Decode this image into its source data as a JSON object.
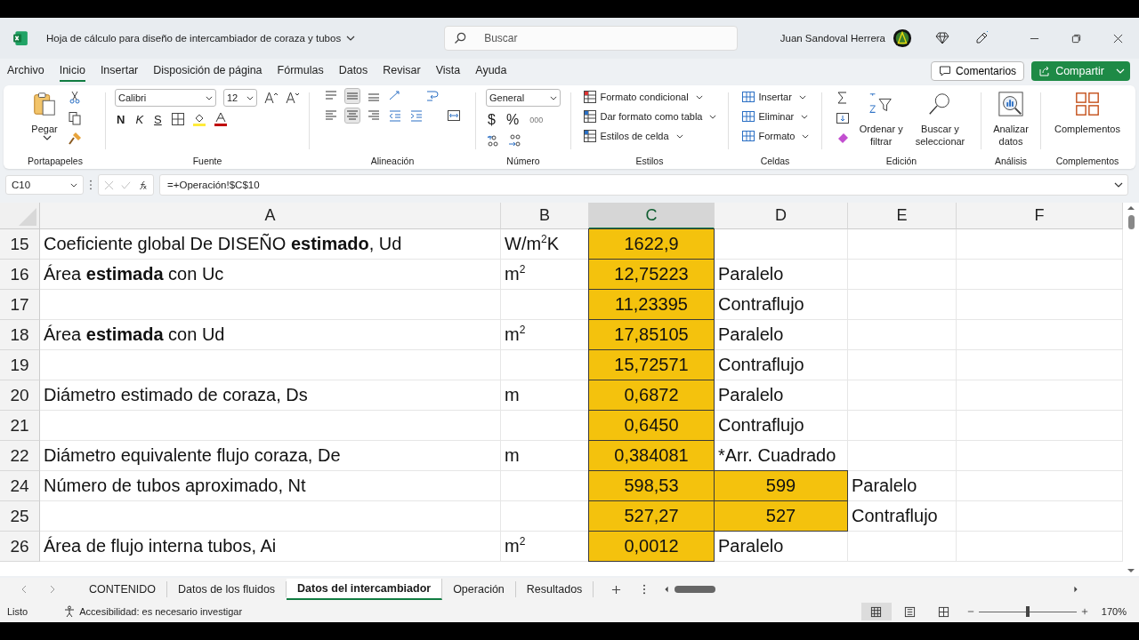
{
  "title_bar": {
    "document_title": "Hoja de cálculo para diseño de intercambiador de coraza y tubos",
    "search_placeholder": "Buscar",
    "user_name": "Juan Sandoval Herrera"
  },
  "menu_tabs": [
    {
      "label": "Archivo",
      "selected": false
    },
    {
      "label": "Inicio",
      "selected": true
    },
    {
      "label": "Insertar",
      "selected": false
    },
    {
      "label": "Disposición de página",
      "selected": false
    },
    {
      "label": "Fórmulas",
      "selected": false
    },
    {
      "label": "Datos",
      "selected": false
    },
    {
      "label": "Revisar",
      "selected": false
    },
    {
      "label": "Vista",
      "selected": false
    },
    {
      "label": "Ayuda",
      "selected": false
    }
  ],
  "actions": {
    "comments": "Comentarios",
    "share": "Compartir"
  },
  "ribbon": {
    "clipboard": {
      "paste": "Pegar",
      "label": "Portapapeles"
    },
    "font": {
      "name": "Calibri",
      "size": "12",
      "bold": "N",
      "italic": "K",
      "underline": "S",
      "label": "Fuente"
    },
    "alignment": {
      "label": "Alineación"
    },
    "number": {
      "format": "General",
      "currency": "$",
      "percent": "%",
      "thousands": "000",
      "label": "Número"
    },
    "styles": {
      "items": [
        "Formato condicional",
        "Dar formato como tabla",
        "Estilos de celda"
      ],
      "label": "Estilos"
    },
    "cells": {
      "items": [
        "Insertar",
        "Eliminar",
        "Formato"
      ],
      "label": "Celdas"
    },
    "editing": {
      "sort": [
        "Ordenar y",
        "filtrar"
      ],
      "find": [
        "Buscar y",
        "seleccionar"
      ],
      "label": "Edición"
    },
    "analysis": {
      "button": [
        "Analizar",
        "datos"
      ],
      "label": "Análisis"
    },
    "addins": {
      "button": "Complementos",
      "label": "Complementos"
    }
  },
  "formula_bar": {
    "name_box": "C10",
    "formula": "=+Operación!$C$10"
  },
  "columns": [
    {
      "label": "A",
      "selected": false
    },
    {
      "label": "B",
      "selected": false
    },
    {
      "label": "C",
      "selected": true
    },
    {
      "label": "D",
      "selected": false
    },
    {
      "label": "E",
      "selected": false
    },
    {
      "label": "F",
      "selected": false
    }
  ],
  "rows": [
    {
      "number": "15",
      "cells": [
        {
          "text": "Coeficiente global De DISEÑO **estimado**, Ud",
          "fill": false
        },
        {
          "text": "W/m$^{2}$K",
          "fill": false
        },
        {
          "text": "1622,9",
          "fill": true
        },
        null,
        null,
        null
      ]
    },
    {
      "number": "16",
      "cells": [
        {
          "text": "Área **estimada** con Uc",
          "fill": false
        },
        {
          "text": "m$^{2}$",
          "fill": false
        },
        {
          "text": "12,75223",
          "fill": true
        },
        {
          "text": "Paralelo",
          "fill": false
        },
        null,
        null
      ]
    },
    {
      "number": "17",
      "cells": [
        null,
        null,
        {
          "text": "11,23395",
          "fill": true
        },
        {
          "text": "Contraflujo",
          "fill": false
        },
        null,
        null
      ]
    },
    {
      "number": "18",
      "cells": [
        {
          "text": "Área **estimada** con Ud",
          "fill": false
        },
        {
          "text": "m$^{2}$",
          "fill": false
        },
        {
          "text": "17,85105",
          "fill": true
        },
        {
          "text": "Paralelo",
          "fill": false
        },
        null,
        null
      ]
    },
    {
      "number": "19",
      "cells": [
        null,
        null,
        {
          "text": "15,72571",
          "fill": true
        },
        {
          "text": "Contraflujo",
          "fill": false
        },
        null,
        null
      ]
    },
    {
      "number": "20",
      "cells": [
        {
          "text": "Diámetro estimado de coraza, Ds",
          "fill": false
        },
        {
          "text": "m",
          "fill": false
        },
        {
          "text": "0,6872",
          "fill": true
        },
        {
          "text": "Paralelo",
          "fill": false
        },
        null,
        null
      ]
    },
    {
      "number": "21",
      "cells": [
        null,
        null,
        {
          "text": "0,6450",
          "fill": true
        },
        {
          "text": "Contraflujo",
          "fill": false
        },
        null,
        null
      ]
    },
    {
      "number": "22",
      "cells": [
        {
          "text": "Diámetro equivalente flujo coraza, De",
          "fill": false
        },
        {
          "text": "m",
          "fill": false
        },
        {
          "text": "0,384081",
          "fill": true
        },
        {
          "text": "*Arr. Cuadrado",
          "fill": false
        },
        null,
        null
      ]
    },
    {
      "number": "24",
      "cells": [
        {
          "text": "Número de tubos aproximado, Nt",
          "fill": false
        },
        null,
        {
          "text": "598,53",
          "fill": true
        },
        {
          "text": "599",
          "fill": true
        },
        {
          "text": "Paralelo",
          "fill": false
        },
        null
      ]
    },
    {
      "number": "25",
      "cells": [
        null,
        null,
        {
          "text": "527,27",
          "fill": true
        },
        {
          "text": "527",
          "fill": true
        },
        {
          "text": "Contraflujo",
          "fill": false
        },
        null
      ]
    },
    {
      "number": "26",
      "cells": [
        {
          "text": "Área de flujo interna tubos, Ai",
          "fill": false
        },
        {
          "text": "m$^{2}$",
          "fill": false
        },
        {
          "text": "0,0012",
          "fill": true
        },
        {
          "text": "Paralelo",
          "fill": false
        },
        null,
        null
      ]
    }
  ],
  "sheet_tabs": [
    {
      "label": "CONTENIDO",
      "selected": false
    },
    {
      "label": "Datos de los fluidos",
      "selected": false
    },
    {
      "label": "Datos del intercambiador",
      "selected": true
    },
    {
      "label": "Operación",
      "selected": false
    },
    {
      "label": "Resultados",
      "selected": false
    }
  ],
  "status_bar": {
    "ready": "Listo",
    "accessibility": "Accesibilidad: es necesario investigar",
    "views": [
      {
        "selected": true
      },
      {
        "selected": false
      },
      {
        "selected": false
      }
    ],
    "zoom_slider": {
      "level": 0.5
    },
    "zoom": "170%"
  }
}
